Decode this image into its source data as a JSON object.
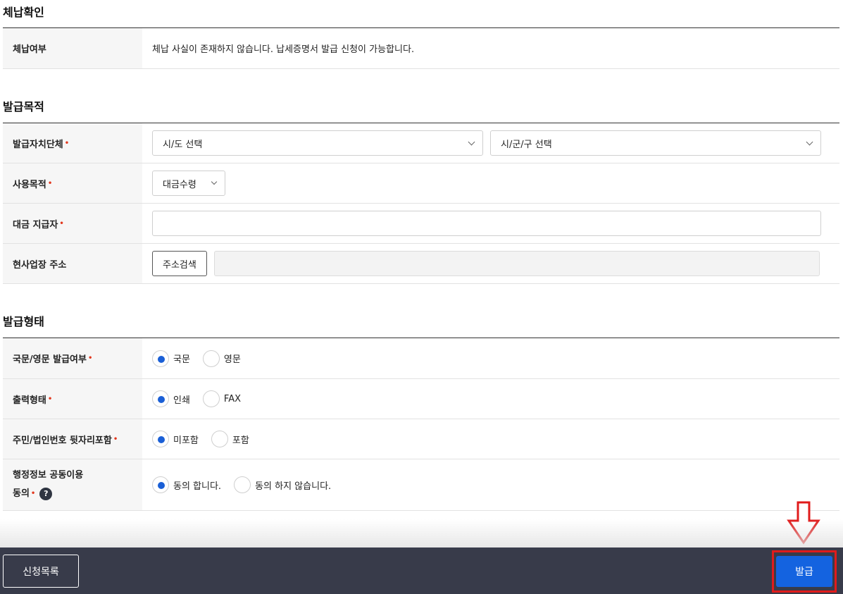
{
  "sections": {
    "delinquency": {
      "title": "체납확인",
      "row_label": "체납여부",
      "row_value": "체납 사실이 존재하지 않습니다. 납세증명서 발급 신청이 가능합니다."
    },
    "purpose": {
      "title": "발급목적",
      "authority_label": "발급자치단체",
      "sido_select": "시/도 선택",
      "sigungu_select": "시/군/구 선택",
      "usage_label": "사용목적",
      "usage_select": "대금수령",
      "payer_label": "대금 지급자",
      "payer_value": "",
      "address_label": "현사업장 주소",
      "address_search_button": "주소검색",
      "address_value": ""
    },
    "format": {
      "title": "발급형태",
      "language_label": "국문/영문 발급여부",
      "language_options": [
        "국문",
        "영문"
      ],
      "output_label": "출력형태",
      "output_options": [
        "인쇄",
        "FAX"
      ],
      "resident_label": "주민/법인번호 뒷자리포함",
      "resident_options": [
        "미포함",
        "포함"
      ],
      "consent_label_line1": "행정정보 공동이용",
      "consent_label_line2": "동의",
      "consent_help": "?",
      "consent_options": [
        "동의 합니다.",
        "동의 하지 않습니다."
      ]
    }
  },
  "required_mark": "•",
  "footer": {
    "list_button": "신청목록",
    "issue_button": "발급"
  },
  "colors": {
    "accent": "#1463e0",
    "required": "#e2381e",
    "footer_bg": "#383b4a",
    "highlight": "#e01b1b"
  }
}
